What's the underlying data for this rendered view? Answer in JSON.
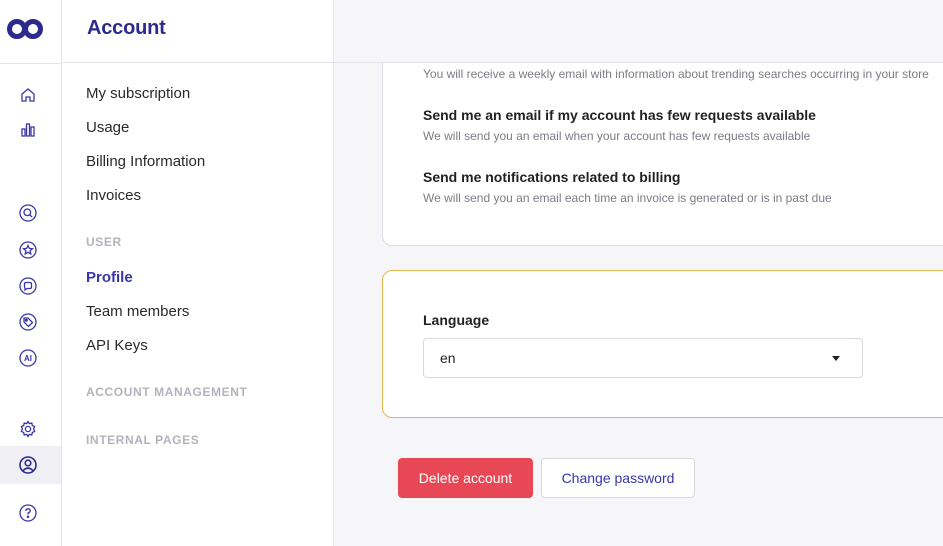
{
  "rail": {
    "icons": [
      "logo-icon",
      "home-icon",
      "bar-chart-icon",
      "search-icon",
      "star-icon",
      "chat-icon",
      "tag-icon",
      "ai-icon",
      "gear-icon",
      "user-icon",
      "help-icon"
    ],
    "ai_label": "AI",
    "accent": "#3a35a8"
  },
  "sidebar": {
    "title": "Account",
    "billing_items": [
      {
        "label": "My subscription"
      },
      {
        "label": "Usage"
      },
      {
        "label": "Billing Information"
      },
      {
        "label": "Invoices"
      }
    ],
    "user_section": "USER",
    "user_items": [
      {
        "label": "Profile",
        "active": true
      },
      {
        "label": "Team members"
      },
      {
        "label": "API Keys"
      }
    ],
    "account_management_section": "ACCOUNT MANAGEMENT",
    "internal_pages_section": "INTERNAL PAGES"
  },
  "notifications": {
    "weekly_desc": "You will receive a weekly email with information about trending searches occurring in your store",
    "options": [
      {
        "title": "Send me an email if my account has few requests available",
        "desc": "We will send you an email when your account has few requests available"
      },
      {
        "title": "Send me notifications related to billing",
        "desc": "We will send you an email each time an invoice is generated or is in past due"
      }
    ]
  },
  "language": {
    "label": "Language",
    "value": "en"
  },
  "actions": {
    "delete_label": "Delete account",
    "change_password_label": "Change password"
  },
  "colors": {
    "brand": "#2c2a8c",
    "accent": "#3a35a8",
    "danger": "#e84855",
    "highlight_border": "#e4b84a"
  }
}
